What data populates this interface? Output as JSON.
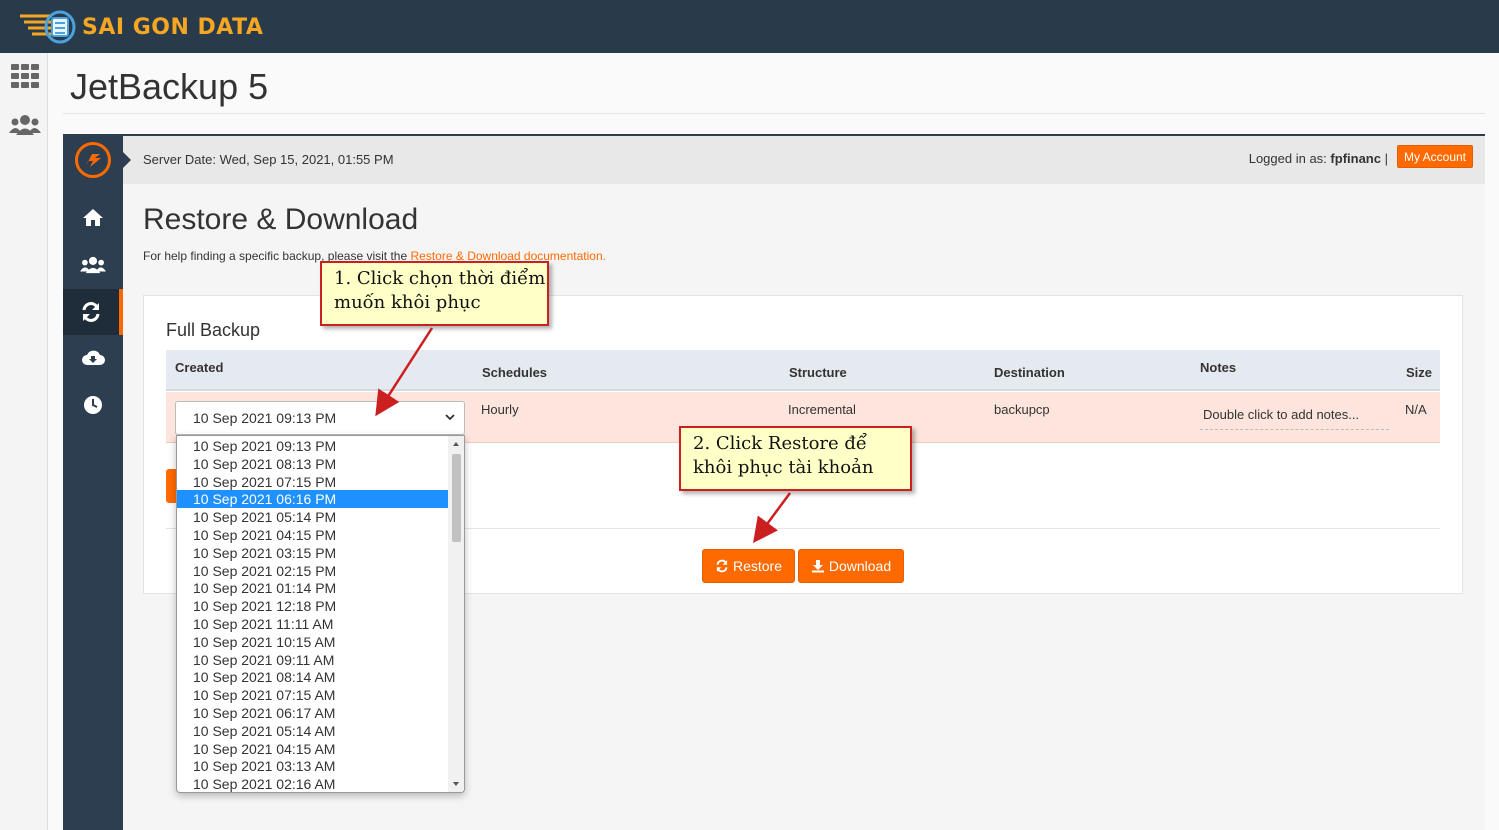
{
  "brand": {
    "logo_text": "SAI GON DATA"
  },
  "page": {
    "title": "JetBackup 5"
  },
  "header": {
    "server_date": "Server Date: Wed, Sep 15, 2021, 01:55 PM",
    "logged_in_prefix": "Logged in as:",
    "username": "fpfinanc",
    "separator": "|",
    "my_account": "My Account"
  },
  "main": {
    "title": "Restore & Download",
    "help_prefix": "For help finding a specific backup, please visit the",
    "help_link": "Restore & Download documentation."
  },
  "panel": {
    "title": "Full Backup",
    "columns": [
      "Created",
      "Schedules",
      "Structure",
      "Destination",
      "Notes",
      "Size"
    ],
    "row": {
      "created": "10 Sep 2021 09:13 PM",
      "schedules": "Hourly",
      "structure": "Incremental",
      "destination": "backupcp",
      "notes": "Double click to add notes...",
      "size": "N/A"
    },
    "restore_label": "Restore",
    "download_label": "Download"
  },
  "dropdown": {
    "options": [
      "10 Sep 2021 09:13 PM",
      "10 Sep 2021 08:13 PM",
      "10 Sep 2021 07:15 PM",
      "10 Sep 2021 06:16 PM",
      "10 Sep 2021 05:14 PM",
      "10 Sep 2021 04:15 PM",
      "10 Sep 2021 03:15 PM",
      "10 Sep 2021 02:15 PM",
      "10 Sep 2021 01:14 PM",
      "10 Sep 2021 12:18 PM",
      "10 Sep 2021 11:11 AM",
      "10 Sep 2021 10:15 AM",
      "10 Sep 2021 09:11 AM",
      "10 Sep 2021 08:14 AM",
      "10 Sep 2021 07:15 AM",
      "10 Sep 2021 06:17 AM",
      "10 Sep 2021 05:14 AM",
      "10 Sep 2021 04:15 AM",
      "10 Sep 2021 03:13 AM",
      "10 Sep 2021 02:16 AM"
    ],
    "selected": "10 Sep 2021 06:16 PM"
  },
  "callouts": {
    "step1": [
      "1. Click chọn thời điểm",
      "muốn khôi phục"
    ],
    "step2": [
      "2. Click Restore để",
      "khôi phục tài khoản"
    ]
  },
  "colors": {
    "accent": "#ff6a00",
    "topbar": "#293a4a",
    "sidenav": "#2c3e50",
    "selected": "#1e90ff",
    "callout_border": "#cc1f1f",
    "callout_bg": "#ffffc8"
  },
  "icons": {
    "rail": [
      "grid-icon",
      "users-icon"
    ],
    "sidenav": [
      "jetbackup-logo-icon",
      "home-icon",
      "users-icon",
      "restore-icon",
      "cloud-download-icon",
      "clock-icon"
    ]
  }
}
